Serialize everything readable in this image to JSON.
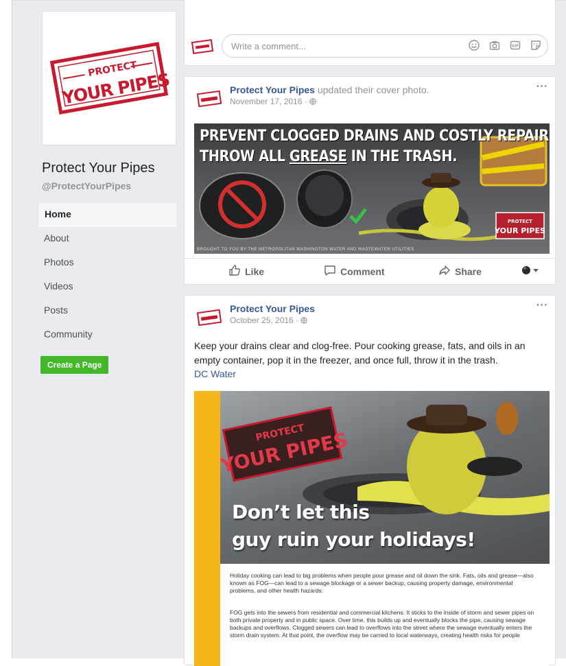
{
  "page": {
    "name": "Protect Your Pipes",
    "handle": "@ProtectYourPipes",
    "logo_line1": "PROTECT",
    "logo_line2": "YOUR PIPES"
  },
  "nav": {
    "items": [
      {
        "label": "Home",
        "active": true
      },
      {
        "label": "About",
        "active": false
      },
      {
        "label": "Photos",
        "active": false
      },
      {
        "label": "Videos",
        "active": false
      },
      {
        "label": "Posts",
        "active": false
      },
      {
        "label": "Community",
        "active": false
      }
    ],
    "create_page": "Create a Page"
  },
  "comment": {
    "placeholder": "Write a comment..."
  },
  "post1": {
    "author": "Protect Your Pipes",
    "action": "updated their cover photo.",
    "date": "November 17, 2016 ·",
    "cover_line1": "PREVENT CLOGGED DRAINS AND COSTLY REPAIRS.",
    "cover_line2_pre": "THROW ALL ",
    "cover_line2_u": "GREASE",
    "cover_line2_post": " IN THE TRASH.",
    "cover_credit": "BROUGHT TO YOU BY THE METROPOLITAN WASHINGTON WATER AND WASTEWATER UTILITIES",
    "like": "Like",
    "comment": "Comment",
    "share": "Share"
  },
  "post2": {
    "author": "Protect Your Pipes",
    "date": "October 25, 2016 ·",
    "text": "Keep your drains clear and clog-free. Pour cooking grease, fats, and oils in an empty container, pop it in the freezer, and once full, throw it in the trash.",
    "link": "DC Water",
    "headline1": "Don’t let this",
    "headline2": "guy ruin your holidays!",
    "para1": "Holiday cooking can lead to big problems when people pour grease and oil down the sink. Fats, oils and grease—also known as FOG—can lead to a sewage blockage or a sewer backup, causing property damage, environmental problems, and other health hazards.",
    "para2": "FOG gets into the sewers from residential and commercial kitchens. It sticks to the inside of storm and sewer pipes on both private property and in public space. Over time, this builds up and eventually blocks the pipe, causing sewage backups and overflows. Clogged sewers can lead to overflows into the street where the sewage eventually enters the storm drain system. At that point, the overflow may be carried to local waterways, creating health risks for people"
  },
  "colors": {
    "link_blue": "#365899",
    "green_button": "#42b72a",
    "page_bg": "#e9ebee",
    "logo_red": "#c8192e",
    "banner_yellow": "#f6b518"
  }
}
